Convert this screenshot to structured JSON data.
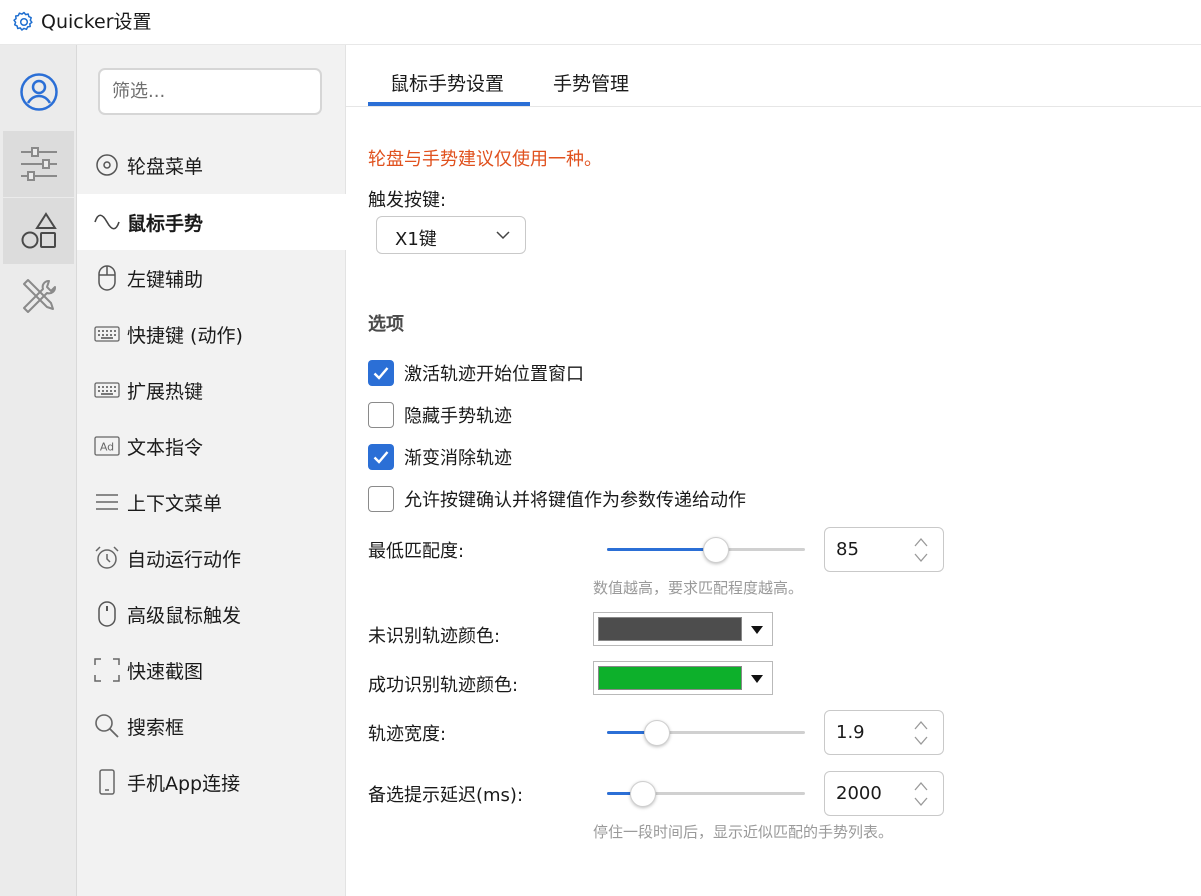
{
  "window": {
    "title": "Quicker设置"
  },
  "nav": {
    "filter_placeholder": "筛选...",
    "items": [
      {
        "label": "轮盘菜单",
        "icon": "target-circle-icon",
        "active": false
      },
      {
        "label": "鼠标手势",
        "icon": "wave-icon",
        "active": true
      },
      {
        "label": "左键辅助",
        "icon": "mouse-icon",
        "active": false
      },
      {
        "label": "快捷键 (动作)",
        "icon": "keyboard-icon",
        "active": false
      },
      {
        "label": "扩展热键",
        "icon": "keyboard-icon",
        "active": false
      },
      {
        "label": "文本指令",
        "icon": "ad-text-icon",
        "active": false
      },
      {
        "label": "上下文菜单",
        "icon": "hamburger-menu-icon",
        "active": false
      },
      {
        "label": "自动运行动作",
        "icon": "alarm-clock-icon",
        "active": false
      },
      {
        "label": "高级鼠标触发",
        "icon": "mouse-icon",
        "active": false
      },
      {
        "label": "快速截图",
        "icon": "screenshot-frame-icon",
        "active": false
      },
      {
        "label": "搜索框",
        "icon": "search-icon",
        "active": false
      },
      {
        "label": "手机App连接",
        "icon": "phone-icon",
        "active": false
      }
    ]
  },
  "rail": [
    {
      "icon": "user-profile-icon"
    },
    {
      "icon": "sliders-icon"
    },
    {
      "icon": "shapes-icon"
    },
    {
      "icon": "tools-icon"
    }
  ],
  "tabs": [
    {
      "label": "鼠标手势设置",
      "active": true
    },
    {
      "label": "手势管理",
      "active": false
    }
  ],
  "settings": {
    "warning": "轮盘与手势建议仅使用一种。",
    "trigger_label": "触发按键:",
    "trigger_value": "X1键",
    "options_heading": "选项",
    "checkboxes": [
      {
        "label": "激活轨迹开始位置窗口",
        "checked": true
      },
      {
        "label": "隐藏手势轨迹",
        "checked": false
      },
      {
        "label": "渐变消除轨迹",
        "checked": true
      },
      {
        "label": "允许按键确认并将键值作为参数传递给动作",
        "checked": false
      }
    ],
    "min_match": {
      "label": "最低匹配度:",
      "value": "85",
      "fraction": 0.55,
      "hint": "数值越高，要求匹配程度越高。"
    },
    "unrecognized_color": {
      "label": "未识别轨迹颜色:",
      "color": "#4d4d4d"
    },
    "recognized_color": {
      "label": "成功识别轨迹颜色:",
      "color": "#0db02b"
    },
    "track_width": {
      "label": "轨迹宽度:",
      "value": "1.9",
      "fraction": 0.25
    },
    "hint_delay": {
      "label": "备选提示延迟(ms):",
      "value": "2000",
      "fraction": 0.18,
      "hint": "停住一段时间后，显示近似匹配的手势列表。"
    }
  },
  "colors": {
    "accent": "#2b6fd6",
    "warning": "#e0511e"
  }
}
